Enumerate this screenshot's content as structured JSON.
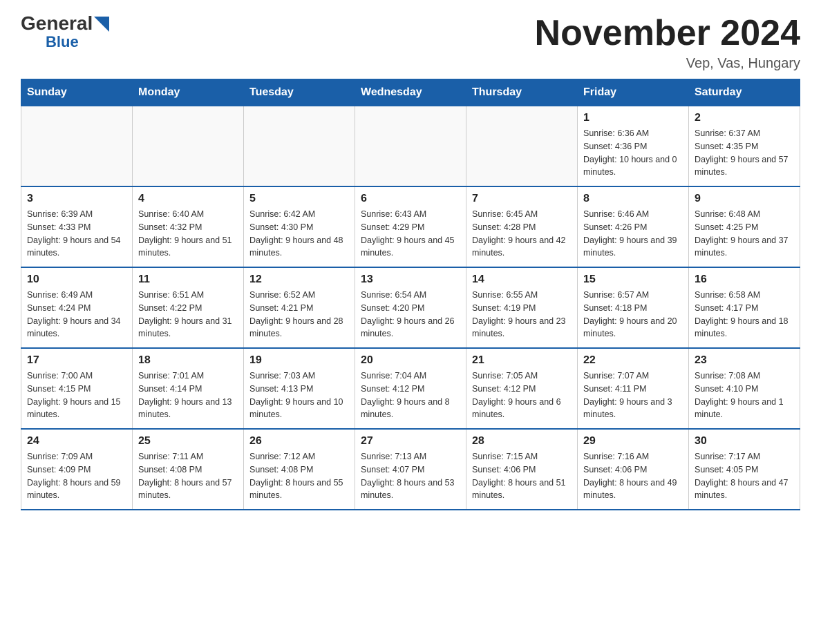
{
  "header": {
    "logo_general": "General",
    "logo_blue": "Blue",
    "month_title": "November 2024",
    "location": "Vep, Vas, Hungary"
  },
  "calendar": {
    "days_of_week": [
      "Sunday",
      "Monday",
      "Tuesday",
      "Wednesday",
      "Thursday",
      "Friday",
      "Saturday"
    ],
    "weeks": [
      [
        {
          "day": "",
          "info": ""
        },
        {
          "day": "",
          "info": ""
        },
        {
          "day": "",
          "info": ""
        },
        {
          "day": "",
          "info": ""
        },
        {
          "day": "",
          "info": ""
        },
        {
          "day": "1",
          "info": "Sunrise: 6:36 AM\nSunset: 4:36 PM\nDaylight: 10 hours and 0 minutes."
        },
        {
          "day": "2",
          "info": "Sunrise: 6:37 AM\nSunset: 4:35 PM\nDaylight: 9 hours and 57 minutes."
        }
      ],
      [
        {
          "day": "3",
          "info": "Sunrise: 6:39 AM\nSunset: 4:33 PM\nDaylight: 9 hours and 54 minutes."
        },
        {
          "day": "4",
          "info": "Sunrise: 6:40 AM\nSunset: 4:32 PM\nDaylight: 9 hours and 51 minutes."
        },
        {
          "day": "5",
          "info": "Sunrise: 6:42 AM\nSunset: 4:30 PM\nDaylight: 9 hours and 48 minutes."
        },
        {
          "day": "6",
          "info": "Sunrise: 6:43 AM\nSunset: 4:29 PM\nDaylight: 9 hours and 45 minutes."
        },
        {
          "day": "7",
          "info": "Sunrise: 6:45 AM\nSunset: 4:28 PM\nDaylight: 9 hours and 42 minutes."
        },
        {
          "day": "8",
          "info": "Sunrise: 6:46 AM\nSunset: 4:26 PM\nDaylight: 9 hours and 39 minutes."
        },
        {
          "day": "9",
          "info": "Sunrise: 6:48 AM\nSunset: 4:25 PM\nDaylight: 9 hours and 37 minutes."
        }
      ],
      [
        {
          "day": "10",
          "info": "Sunrise: 6:49 AM\nSunset: 4:24 PM\nDaylight: 9 hours and 34 minutes."
        },
        {
          "day": "11",
          "info": "Sunrise: 6:51 AM\nSunset: 4:22 PM\nDaylight: 9 hours and 31 minutes."
        },
        {
          "day": "12",
          "info": "Sunrise: 6:52 AM\nSunset: 4:21 PM\nDaylight: 9 hours and 28 minutes."
        },
        {
          "day": "13",
          "info": "Sunrise: 6:54 AM\nSunset: 4:20 PM\nDaylight: 9 hours and 26 minutes."
        },
        {
          "day": "14",
          "info": "Sunrise: 6:55 AM\nSunset: 4:19 PM\nDaylight: 9 hours and 23 minutes."
        },
        {
          "day": "15",
          "info": "Sunrise: 6:57 AM\nSunset: 4:18 PM\nDaylight: 9 hours and 20 minutes."
        },
        {
          "day": "16",
          "info": "Sunrise: 6:58 AM\nSunset: 4:17 PM\nDaylight: 9 hours and 18 minutes."
        }
      ],
      [
        {
          "day": "17",
          "info": "Sunrise: 7:00 AM\nSunset: 4:15 PM\nDaylight: 9 hours and 15 minutes."
        },
        {
          "day": "18",
          "info": "Sunrise: 7:01 AM\nSunset: 4:14 PM\nDaylight: 9 hours and 13 minutes."
        },
        {
          "day": "19",
          "info": "Sunrise: 7:03 AM\nSunset: 4:13 PM\nDaylight: 9 hours and 10 minutes."
        },
        {
          "day": "20",
          "info": "Sunrise: 7:04 AM\nSunset: 4:12 PM\nDaylight: 9 hours and 8 minutes."
        },
        {
          "day": "21",
          "info": "Sunrise: 7:05 AM\nSunset: 4:12 PM\nDaylight: 9 hours and 6 minutes."
        },
        {
          "day": "22",
          "info": "Sunrise: 7:07 AM\nSunset: 4:11 PM\nDaylight: 9 hours and 3 minutes."
        },
        {
          "day": "23",
          "info": "Sunrise: 7:08 AM\nSunset: 4:10 PM\nDaylight: 9 hours and 1 minute."
        }
      ],
      [
        {
          "day": "24",
          "info": "Sunrise: 7:09 AM\nSunset: 4:09 PM\nDaylight: 8 hours and 59 minutes."
        },
        {
          "day": "25",
          "info": "Sunrise: 7:11 AM\nSunset: 4:08 PM\nDaylight: 8 hours and 57 minutes."
        },
        {
          "day": "26",
          "info": "Sunrise: 7:12 AM\nSunset: 4:08 PM\nDaylight: 8 hours and 55 minutes."
        },
        {
          "day": "27",
          "info": "Sunrise: 7:13 AM\nSunset: 4:07 PM\nDaylight: 8 hours and 53 minutes."
        },
        {
          "day": "28",
          "info": "Sunrise: 7:15 AM\nSunset: 4:06 PM\nDaylight: 8 hours and 51 minutes."
        },
        {
          "day": "29",
          "info": "Sunrise: 7:16 AM\nSunset: 4:06 PM\nDaylight: 8 hours and 49 minutes."
        },
        {
          "day": "30",
          "info": "Sunrise: 7:17 AM\nSunset: 4:05 PM\nDaylight: 8 hours and 47 minutes."
        }
      ]
    ]
  }
}
